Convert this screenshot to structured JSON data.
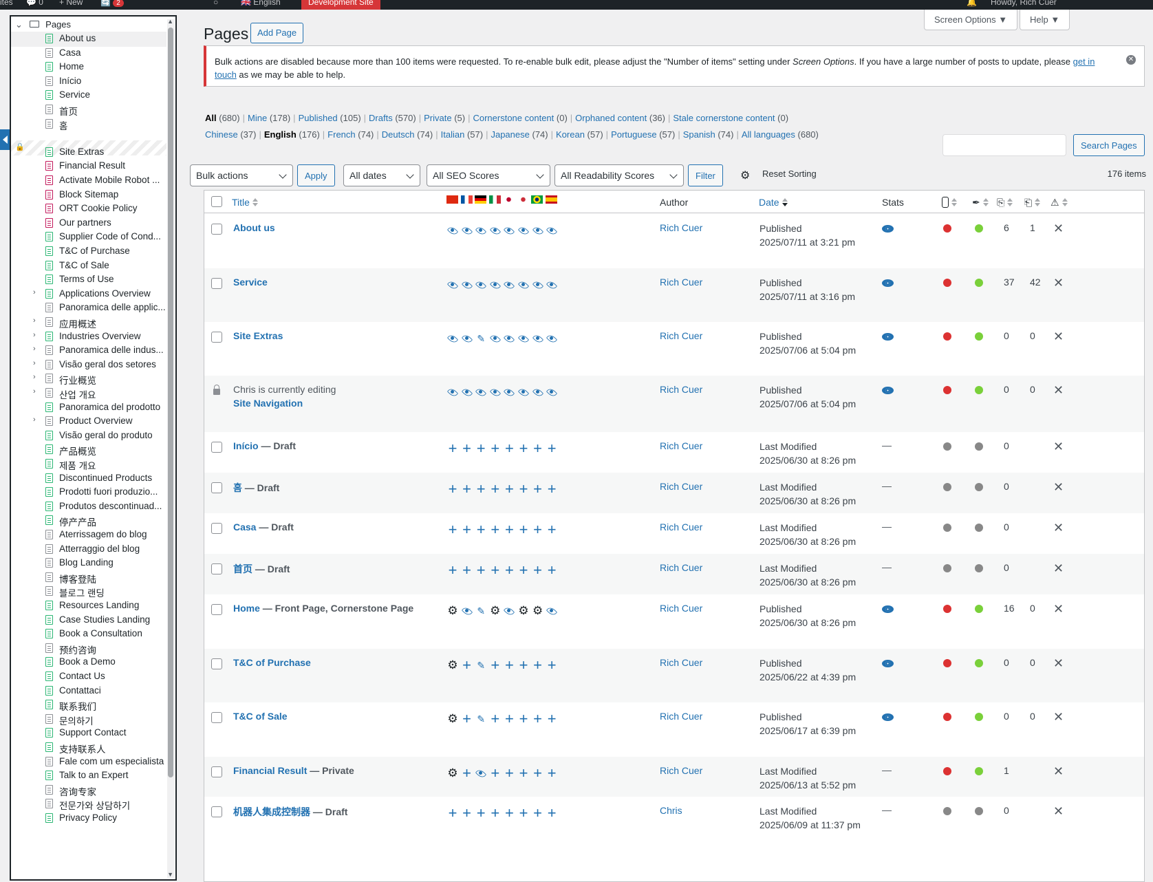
{
  "adminbar": {
    "left_stub": "ites",
    "comments_count": "0",
    "new_label": "New",
    "updates_count": "2",
    "language": "English",
    "dev_site": "Development Site",
    "howdy": "Howdy, Rich Cuer"
  },
  "tree": {
    "root_label": "Pages",
    "items": [
      {
        "label": "About us",
        "color": "green"
      },
      {
        "label": "Casa",
        "color": "gray"
      },
      {
        "label": "Home",
        "color": "green"
      },
      {
        "label": "Início",
        "color": "gray"
      },
      {
        "label": "Service",
        "color": "green"
      },
      {
        "label": "首页",
        "color": "gray"
      },
      {
        "label": "홈",
        "color": "gray"
      },
      {
        "label": "",
        "color": "locked"
      },
      {
        "label": "Site Extras",
        "color": "green"
      },
      {
        "label": "Financial Result",
        "color": "pink"
      },
      {
        "label": "Activate Mobile Robot ...",
        "color": "pink"
      },
      {
        "label": "Block Sitemap",
        "color": "pink"
      },
      {
        "label": "ORT Cookie Policy",
        "color": "pink"
      },
      {
        "label": "Our partners",
        "color": "pink"
      },
      {
        "label": "Supplier Code of Cond...",
        "color": "green"
      },
      {
        "label": "T&C of Purchase",
        "color": "green"
      },
      {
        "label": "T&C of Sale",
        "color": "green"
      },
      {
        "label": "Terms of Use",
        "color": "green"
      },
      {
        "label": "Applications Overview",
        "color": "green",
        "expand": true
      },
      {
        "label": "Panoramica delle applic...",
        "color": "gray"
      },
      {
        "label": "应用概述",
        "color": "gray",
        "expand": true
      },
      {
        "label": "Industries Overview",
        "color": "green",
        "expand": true
      },
      {
        "label": "Panoramica delle indus...",
        "color": "gray",
        "expand": true
      },
      {
        "label": "Visão geral dos setores",
        "color": "gray",
        "expand": true
      },
      {
        "label": "行业概览",
        "color": "gray",
        "expand": true
      },
      {
        "label": "산업 개요",
        "color": "gray",
        "expand": true
      },
      {
        "label": "Panoramica del prodotto",
        "color": "green"
      },
      {
        "label": "Product Overview",
        "color": "gray",
        "expand": true
      },
      {
        "label": "Visão geral do produto",
        "color": "green"
      },
      {
        "label": "产品概览",
        "color": "green"
      },
      {
        "label": "제품 개요",
        "color": "green"
      },
      {
        "label": "Discontinued Products",
        "color": "green"
      },
      {
        "label": "Prodotti fuori produzio...",
        "color": "green"
      },
      {
        "label": "Produtos descontinuad...",
        "color": "green"
      },
      {
        "label": "停产产品",
        "color": "green"
      },
      {
        "label": "Aterrissagem do blog",
        "color": "gray"
      },
      {
        "label": "Atterraggio del blog",
        "color": "gray"
      },
      {
        "label": "Blog Landing",
        "color": "gray"
      },
      {
        "label": "博客登陆",
        "color": "gray"
      },
      {
        "label": "블로그 랜딩",
        "color": "gray"
      },
      {
        "label": "Resources Landing",
        "color": "green"
      },
      {
        "label": "Case Studies Landing",
        "color": "green"
      },
      {
        "label": "Book a Consultation",
        "color": "green"
      },
      {
        "label": "预约咨询",
        "color": "gray"
      },
      {
        "label": "Book a Demo",
        "color": "green"
      },
      {
        "label": "Contact Us",
        "color": "green"
      },
      {
        "label": "Contattaci",
        "color": "green"
      },
      {
        "label": "联系我们",
        "color": "green"
      },
      {
        "label": "문의하기",
        "color": "gray"
      },
      {
        "label": "Support Contact",
        "color": "green"
      },
      {
        "label": "支持联系人",
        "color": "green"
      },
      {
        "label": "Fale com um especialista",
        "color": "gray"
      },
      {
        "label": "Talk to an Expert",
        "color": "green"
      },
      {
        "label": "咨询专家",
        "color": "gray"
      },
      {
        "label": "전문가와 상담하기",
        "color": "gray"
      },
      {
        "label": "Privacy Policy",
        "color": "green"
      }
    ]
  },
  "header": {
    "screen_options": "Screen Options ▼",
    "help": "Help ▼",
    "title": "Pages",
    "add_page": "Add Page"
  },
  "notice": {
    "text_1": "Bulk actions are disabled because more than 100 items were requested. To re-enable bulk edit, please adjust the \"Number of items\" setting under ",
    "text_em": "Screen Options",
    "text_2": ". If you have a large number of posts to update, please ",
    "link_1": "get in",
    "link_2": "touch",
    "text_3": " as we may be able to help."
  },
  "views": [
    {
      "label": "All",
      "count": "(680)",
      "current": true
    },
    {
      "label": "Mine",
      "count": "(178)"
    },
    {
      "label": "Published",
      "count": "(105)"
    },
    {
      "label": "Drafts",
      "count": "(570)"
    },
    {
      "label": "Private",
      "count": "(5)"
    },
    {
      "label": "Cornerstone content",
      "count": "(0)"
    },
    {
      "label": "Orphaned content",
      "count": "(36)"
    },
    {
      "label": "Stale cornerstone content",
      "count": "(0)"
    }
  ],
  "languages": [
    {
      "label": "Chinese",
      "count": "(37)"
    },
    {
      "label": "English",
      "count": "(176)",
      "current": true
    },
    {
      "label": "French",
      "count": "(74)"
    },
    {
      "label": "Deutsch",
      "count": "(74)"
    },
    {
      "label": "Italian",
      "count": "(57)"
    },
    {
      "label": "Japanese",
      "count": "(74)"
    },
    {
      "label": "Korean",
      "count": "(57)"
    },
    {
      "label": "Portuguese",
      "count": "(57)"
    },
    {
      "label": "Spanish",
      "count": "(74)"
    },
    {
      "label": "All languages",
      "count": "(680)"
    }
  ],
  "search": {
    "button": "Search Pages"
  },
  "filters": {
    "bulk": "Bulk actions",
    "apply": "Apply",
    "dates": "All dates",
    "seo": "All SEO Scores",
    "readability": "All Readability Scores",
    "filter": "Filter",
    "reset": "Reset Sorting",
    "items": "176 items"
  },
  "columns": {
    "title": "Title",
    "author": "Author",
    "date": "Date",
    "stats": "Stats"
  },
  "flag_colors": [
    "#de2910",
    "#0055a4",
    "#000000",
    "#009246",
    "#bc002d",
    "#003478",
    "#009c3b",
    "#c60b1e"
  ],
  "rows": [
    {
      "title": "About us",
      "state": "",
      "langs": [
        "eye",
        "eye",
        "eye",
        "eye",
        "eye",
        "eye",
        "eye",
        "eye"
      ],
      "author": "Rich Cuer",
      "status": "Published",
      "date": "2025/07/11 at 3:21 pm",
      "eye": true,
      "seo": "red",
      "read": "green",
      "n1": "6",
      "n2": "1"
    },
    {
      "title": "Service",
      "state": "",
      "langs": [
        "eye",
        "eye",
        "eye",
        "eye",
        "eye",
        "eye",
        "eye",
        "eye"
      ],
      "author": "Rich Cuer",
      "status": "Published",
      "date": "2025/07/11 at 3:16 pm",
      "eye": true,
      "seo": "red",
      "read": "green",
      "n1": "37",
      "n2": "42"
    },
    {
      "title": "Site Extras",
      "state": "",
      "langs": [
        "eye",
        "eye",
        "pencil",
        "eye",
        "eye",
        "eye",
        "eye",
        "eye"
      ],
      "author": "Rich Cuer",
      "status": "Published",
      "date": "2025/07/06 at 5:04 pm",
      "eye": true,
      "seo": "red",
      "read": "green",
      "n1": "0",
      "n2": "0"
    },
    {
      "title": "Site Navigation",
      "state": "",
      "locked": "Chris is currently editing",
      "langs": [
        "eye",
        "eye",
        "eye",
        "eye",
        "eye",
        "eye",
        "eye",
        "eye"
      ],
      "author": "Rich Cuer",
      "status": "Published",
      "date": "2025/07/06 at 5:04 pm",
      "eye": true,
      "seo": "red",
      "read": "green",
      "n1": "0",
      "n2": "0"
    },
    {
      "title": "Início",
      "state": " — Draft",
      "langs": [
        "plus",
        "plus",
        "plus",
        "plus",
        "plus",
        "plus",
        "plus",
        "plus"
      ],
      "author": "Rich Cuer",
      "status": "Last Modified",
      "date": "2025/06/30 at 8:26 pm",
      "eye": false,
      "seo": "gray",
      "read": "gray",
      "n1": "0",
      "n2": ""
    },
    {
      "title": "홈",
      "state": " — Draft",
      "langs": [
        "plus",
        "plus",
        "plus",
        "plus",
        "plus",
        "plus",
        "plus",
        "plus"
      ],
      "author": "Rich Cuer",
      "status": "Last Modified",
      "date": "2025/06/30 at 8:26 pm",
      "eye": false,
      "seo": "gray",
      "read": "gray",
      "n1": "0",
      "n2": ""
    },
    {
      "title": "Casa",
      "state": " — Draft",
      "langs": [
        "plus",
        "plus",
        "plus",
        "plus",
        "plus",
        "plus",
        "plus",
        "plus"
      ],
      "author": "Rich Cuer",
      "status": "Last Modified",
      "date": "2025/06/30 at 8:26 pm",
      "eye": false,
      "seo": "gray",
      "read": "gray",
      "n1": "0",
      "n2": ""
    },
    {
      "title": "首页",
      "state": " — Draft",
      "langs": [
        "plus",
        "plus",
        "plus",
        "plus",
        "plus",
        "plus",
        "plus",
        "plus"
      ],
      "author": "Rich Cuer",
      "status": "Last Modified",
      "date": "2025/06/30 at 8:26 pm",
      "eye": false,
      "seo": "gray",
      "read": "gray",
      "n1": "0",
      "n2": ""
    },
    {
      "title": "Home",
      "state": " — Front Page, Cornerstone Page",
      "langs": [
        "gear",
        "eye",
        "pencil",
        "gear",
        "eye",
        "gear",
        "gear",
        "eye"
      ],
      "author": "Rich Cuer",
      "status": "Published",
      "date": "2025/06/30 at 8:26 pm",
      "eye": true,
      "seo": "red",
      "read": "green",
      "n1": "16",
      "n2": "0"
    },
    {
      "title": "T&C of Purchase",
      "state": "",
      "langs": [
        "gear",
        "plus",
        "pencil",
        "plus",
        "plus",
        "plus",
        "plus",
        "plus"
      ],
      "author": "Rich Cuer",
      "status": "Published",
      "date": "2025/06/22 at 4:39 pm",
      "eye": true,
      "seo": "red",
      "read": "green",
      "n1": "0",
      "n2": "0"
    },
    {
      "title": "T&C of Sale",
      "state": "",
      "langs": [
        "gear",
        "plus",
        "pencil",
        "plus",
        "plus",
        "plus",
        "plus",
        "plus"
      ],
      "author": "Rich Cuer",
      "status": "Published",
      "date": "2025/06/17 at 6:39 pm",
      "eye": true,
      "seo": "red",
      "read": "green",
      "n1": "0",
      "n2": "0"
    },
    {
      "title": "Financial Result",
      "state": " — Private",
      "langs": [
        "gear",
        "plus",
        "eye",
        "plus",
        "plus",
        "plus",
        "plus",
        "plus"
      ],
      "author": "Rich Cuer",
      "status": "Last Modified",
      "date": "2025/06/13 at 5:52 pm",
      "eye": false,
      "seo": "red",
      "read": "green",
      "n1": "1",
      "n2": ""
    },
    {
      "title": "机器人集成控制器",
      "state": " — Draft",
      "langs": [
        "plus",
        "plus",
        "plus",
        "plus",
        "plus",
        "plus",
        "plus",
        "plus"
      ],
      "author": "Chris",
      "status": "Last Modified",
      "date": "2025/06/09 at 11:37 pm",
      "eye": false,
      "seo": "gray",
      "read": "gray",
      "n1": "0",
      "n2": ""
    }
  ],
  "dash": "—"
}
